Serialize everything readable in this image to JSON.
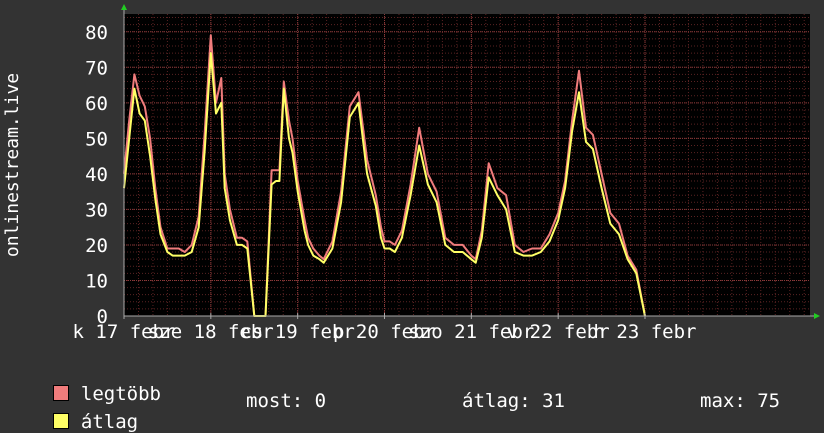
{
  "chart_data": {
    "type": "line",
    "ylabel": "onlinestream.live",
    "ylim": [
      0,
      85
    ],
    "yticks": [
      0,
      10,
      20,
      30,
      40,
      50,
      60,
      70,
      80
    ],
    "xlim": [
      0,
      7.9
    ],
    "xticks": [
      {
        "x": 0.0,
        "label": "k 17 febr"
      },
      {
        "x": 1.0,
        "label": "sze 18 febr"
      },
      {
        "x": 2.0,
        "label": "cs 19 febr"
      },
      {
        "x": 3.0,
        "label": "p 20 febr"
      },
      {
        "x": 4.0,
        "label": "szo 21 febr"
      },
      {
        "x": 5.0,
        "label": "v 22 febr"
      },
      {
        "x": 6.0,
        "label": "h 23 febr"
      }
    ],
    "grid": true,
    "colors": {
      "legtobb": "#f07c7c",
      "atlag": "#ffff66",
      "background": "#333333",
      "plot_bg": "#000000",
      "grid": "#5a2222",
      "axis": "#aaaaaa"
    },
    "x": [
      0.0,
      0.06,
      0.12,
      0.18,
      0.24,
      0.3,
      0.36,
      0.42,
      0.5,
      0.56,
      0.63,
      0.7,
      0.78,
      0.86,
      0.93,
      1.0,
      1.06,
      1.12,
      1.16,
      1.22,
      1.3,
      1.36,
      1.42,
      1.5,
      1.56,
      1.63,
      1.7,
      1.75,
      1.76,
      1.78,
      1.79,
      1.84,
      1.9,
      1.94,
      2.0,
      2.08,
      2.12,
      2.18,
      2.25,
      2.3,
      2.4,
      2.5,
      2.6,
      2.7,
      2.8,
      2.9,
      2.96,
      3.0,
      3.06,
      3.12,
      3.2,
      3.3,
      3.4,
      3.5,
      3.6,
      3.7,
      3.8,
      3.9,
      4.0,
      4.05,
      4.12,
      4.2,
      4.3,
      4.4,
      4.5,
      4.6,
      4.7,
      4.8,
      4.9,
      5.0,
      5.08,
      5.16,
      5.24,
      5.32,
      5.4,
      5.5,
      5.6,
      5.7,
      5.8,
      5.9,
      6.0,
      6.08,
      6.16,
      6.22,
      6.3,
      6.4,
      6.5,
      6.6,
      6.7,
      6.76,
      6.8
    ],
    "series": [
      {
        "name": "legtöbb",
        "values": [
          40,
          55,
          68,
          62,
          59,
          50,
          36,
          25,
          19,
          19,
          19,
          18,
          20,
          28,
          52,
          79,
          60,
          67,
          40,
          30,
          22,
          22,
          21,
          0,
          0,
          0,
          41,
          41,
          41,
          41,
          41,
          66,
          55,
          50,
          38,
          27,
          22,
          19,
          17,
          16,
          21,
          35,
          59,
          63,
          44,
          34,
          25,
          21,
          21,
          20,
          24,
          37,
          53,
          40,
          35,
          22,
          20,
          20,
          17,
          16,
          24,
          43,
          36,
          34,
          20,
          18,
          19,
          19,
          23,
          29,
          38,
          55,
          69,
          53,
          51,
          40,
          29,
          26,
          17,
          13,
          0
        ]
      },
      {
        "name": "átlag",
        "values": [
          36,
          50,
          64,
          57,
          55,
          45,
          33,
          23,
          18,
          17,
          17,
          17,
          18,
          25,
          47,
          74,
          57,
          60,
          36,
          27,
          20,
          20,
          19,
          0,
          0,
          0,
          37,
          38,
          38,
          38,
          38,
          64,
          50,
          46,
          35,
          24,
          20,
          17,
          16,
          15,
          19,
          32,
          56,
          60,
          40,
          31,
          22,
          19,
          19,
          18,
          22,
          34,
          48,
          37,
          32,
          20,
          18,
          18,
          16,
          15,
          22,
          39,
          34,
          30,
          18,
          17,
          17,
          18,
          21,
          27,
          36,
          52,
          63,
          49,
          47,
          36,
          26,
          23,
          16,
          12,
          0
        ]
      }
    ]
  },
  "legend": {
    "items": [
      {
        "label": "legtöbb",
        "color": "#f07c7c"
      },
      {
        "label": "átlag",
        "color": "#ffff66"
      }
    ]
  },
  "stats": {
    "most": "most: 0",
    "atlag": "átlag: 31",
    "max": "max: 75"
  }
}
